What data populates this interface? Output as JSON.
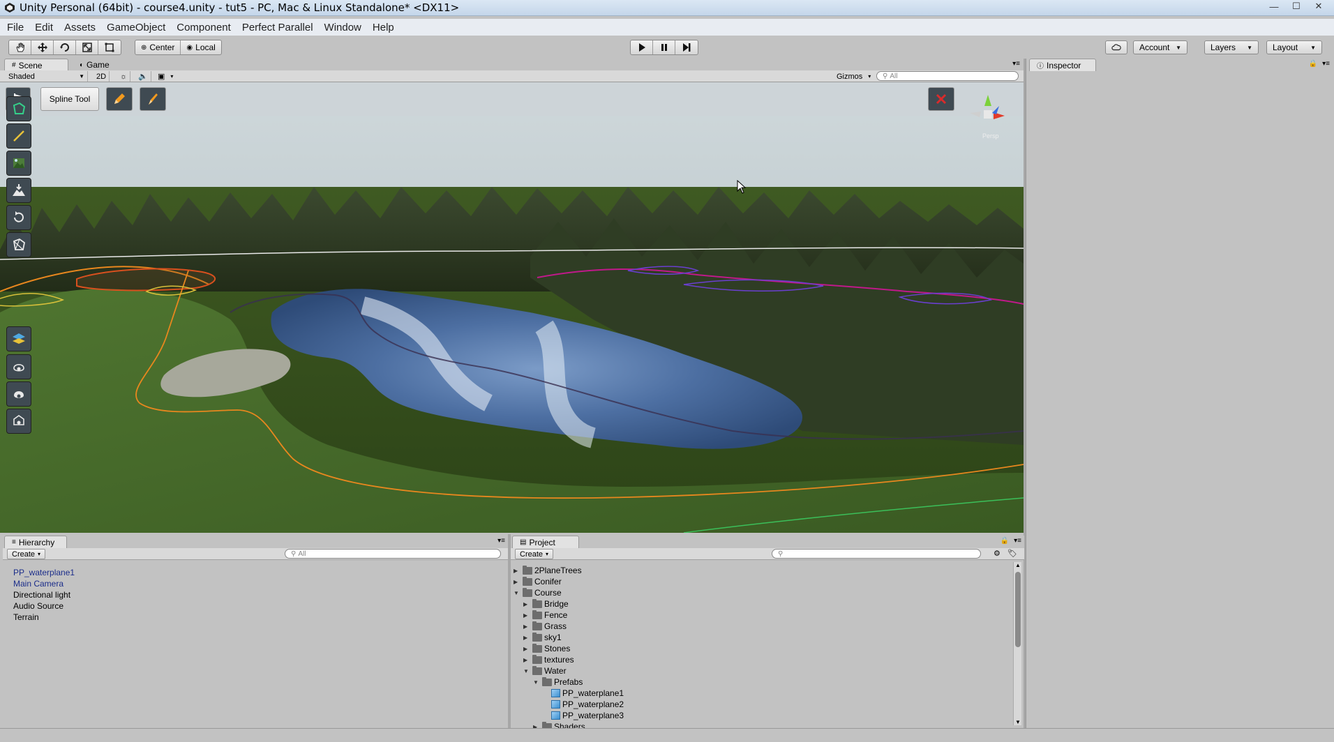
{
  "window": {
    "title": "Unity Personal (64bit) - course4.unity - tut5 - PC, Mac & Linux Standalone* <DX11>",
    "controls": [
      "—",
      "☐",
      "✕"
    ]
  },
  "menu": [
    "File",
    "Edit",
    "Assets",
    "GameObject",
    "Component",
    "Perfect Parallel",
    "Window",
    "Help"
  ],
  "toolbar": {
    "pivot_mode": "Center",
    "pivot_rotation": "Local",
    "account_label": "Account",
    "layers_label": "Layers",
    "layout_label": "Layout"
  },
  "scene": {
    "tabs": [
      {
        "label": "Scene",
        "active": true
      },
      {
        "label": "Game",
        "active": false
      }
    ],
    "shading_mode": "Shaded",
    "mode_2d_label": "2D",
    "gizmos_label": "Gizmos",
    "search_placeholder": "All",
    "gizmo_axis_label": "Persp",
    "spline_tool_label": "Spline Tool"
  },
  "hierarchy": {
    "tab_label": "Hierarchy",
    "create_label": "Create",
    "search_placeholder": "All",
    "items": [
      {
        "label": "PP_waterplane1",
        "highlight": true
      },
      {
        "label": "Main Camera",
        "highlight": true
      },
      {
        "label": "Directional light",
        "highlight": false
      },
      {
        "label": "Audio Source",
        "highlight": false
      },
      {
        "label": "Terrain",
        "highlight": false
      }
    ]
  },
  "project": {
    "tab_label": "Project",
    "create_label": "Create",
    "search_placeholder": "",
    "tree": [
      {
        "label": "2PlaneTrees",
        "depth": 0,
        "expanded": false,
        "kind": "folder"
      },
      {
        "label": "Conifer",
        "depth": 0,
        "expanded": false,
        "kind": "folder"
      },
      {
        "label": "Course",
        "depth": 0,
        "expanded": true,
        "kind": "folder"
      },
      {
        "label": "Bridge",
        "depth": 1,
        "expanded": false,
        "kind": "folder"
      },
      {
        "label": "Fence",
        "depth": 1,
        "expanded": false,
        "kind": "folder"
      },
      {
        "label": "Grass",
        "depth": 1,
        "expanded": false,
        "kind": "folder"
      },
      {
        "label": "sky1",
        "depth": 1,
        "expanded": false,
        "kind": "folder"
      },
      {
        "label": "Stones",
        "depth": 1,
        "expanded": false,
        "kind": "folder"
      },
      {
        "label": "textures",
        "depth": 1,
        "expanded": false,
        "kind": "folder"
      },
      {
        "label": "Water",
        "depth": 1,
        "expanded": true,
        "kind": "folder"
      },
      {
        "label": "Prefabs",
        "depth": 2,
        "expanded": true,
        "kind": "folder"
      },
      {
        "label": "PP_waterplane1",
        "depth": 3,
        "expanded": false,
        "kind": "prefab"
      },
      {
        "label": "PP_waterplane2",
        "depth": 3,
        "expanded": false,
        "kind": "prefab"
      },
      {
        "label": "PP_waterplane3",
        "depth": 3,
        "expanded": false,
        "kind": "prefab"
      },
      {
        "label": "Shaders",
        "depth": 2,
        "expanded": false,
        "kind": "folder"
      }
    ]
  },
  "inspector": {
    "tab_label": "Inspector"
  },
  "colors": {
    "editor_bg": "#c2c2c2",
    "selection_text": "#1b2d8a",
    "tool_bg": "#3f4a52",
    "pencil_orange": "#f39a1e"
  }
}
